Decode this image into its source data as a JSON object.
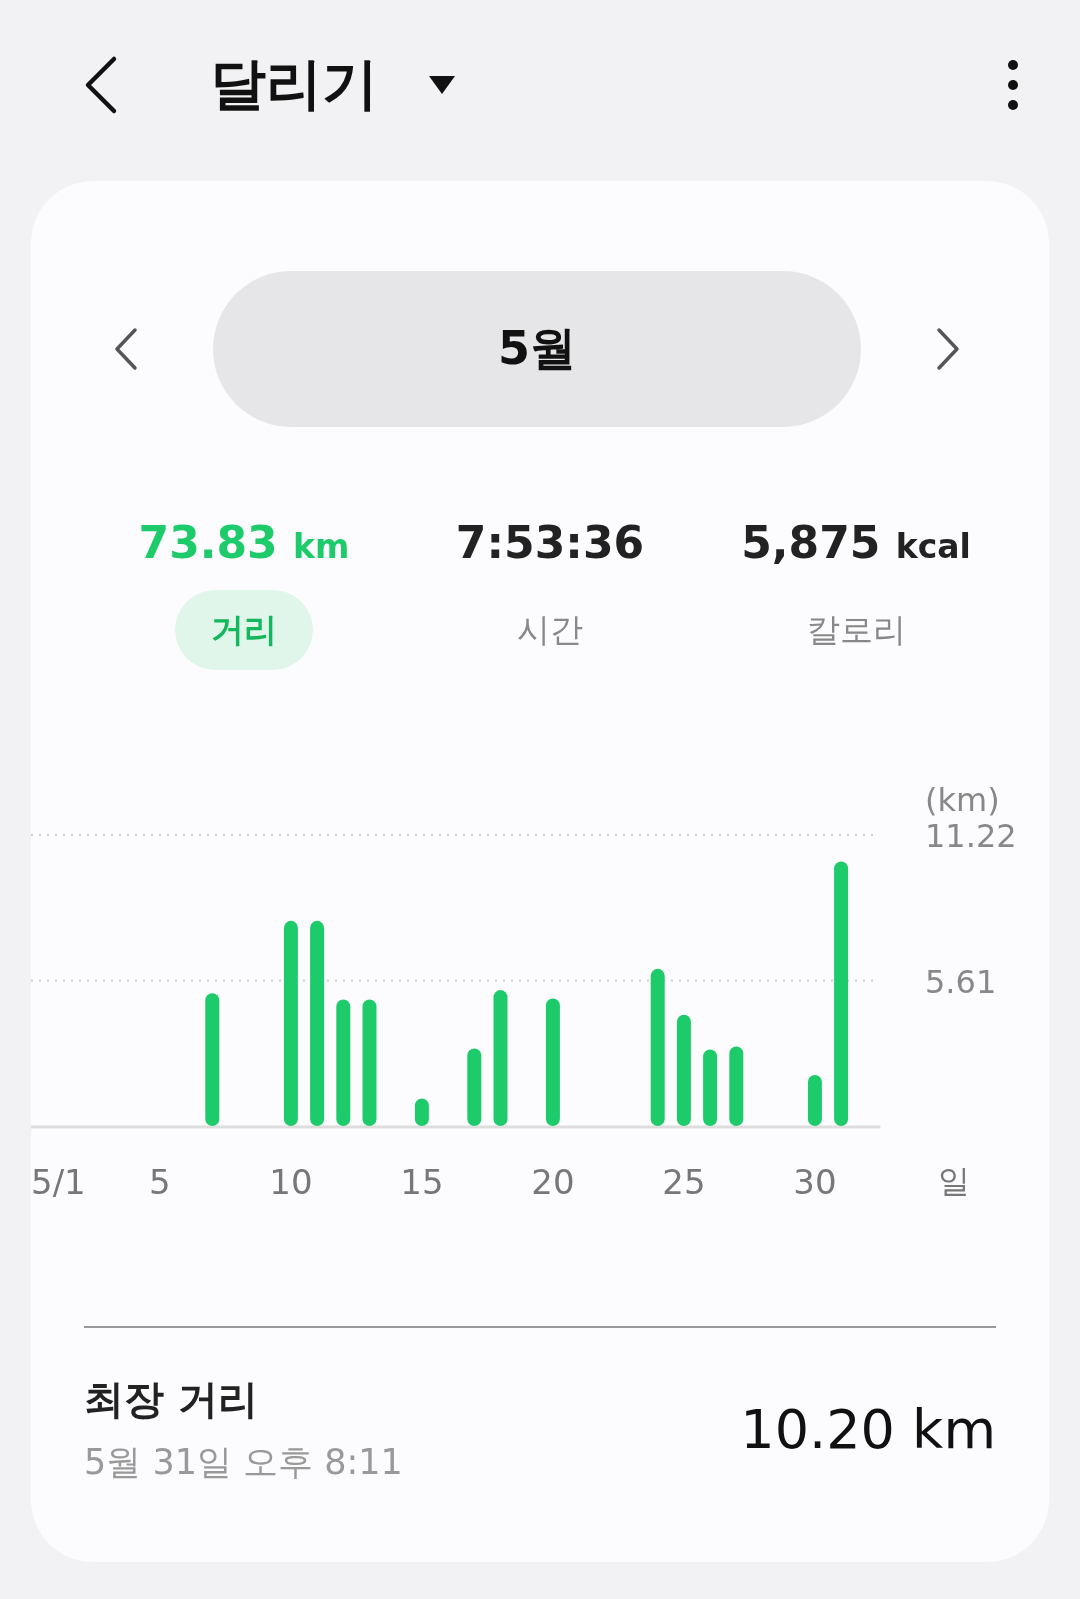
{
  "header": {
    "title": "달리기"
  },
  "period": {
    "label": "5월"
  },
  "metrics": [
    {
      "value": "73.83",
      "unit": "km",
      "label": "거리",
      "selected": true
    },
    {
      "value": "7:53:36",
      "label": "시간",
      "selected": false
    },
    {
      "value": "5,875",
      "unit": "kcal",
      "label": "칼로리",
      "selected": false
    }
  ],
  "chart": {
    "chart_data": {
      "type": "bar",
      "xlabel": "일",
      "ylabel": "(km)",
      "x": [
        7,
        10,
        11,
        12,
        13,
        15,
        17,
        18,
        20,
        24,
        25,
        26,
        27,
        30,
        31
      ],
      "series": [
        {
          "color": "#1ecb6b",
          "values": [
            5.12,
            7.91,
            7.91,
            4.88,
            4.88,
            1.06,
            2.99,
            5.24,
            4.92,
            6.06,
            4.29,
            2.95,
            3.07,
            1.97,
            10.2
          ]
        }
      ],
      "xlim": [
        0.08,
        32.5
      ],
      "ylim": [
        0,
        11.22
      ],
      "yticks": [
        5.61,
        11.22
      ],
      "xticks": [
        {
          "value": 1,
          "label": "5/1"
        },
        5,
        10,
        15,
        20,
        25,
        30
      ]
    }
  },
  "longest": {
    "title": "최장 거리",
    "date": "5월 31일 오후 8:11",
    "value": "10.20 km"
  }
}
